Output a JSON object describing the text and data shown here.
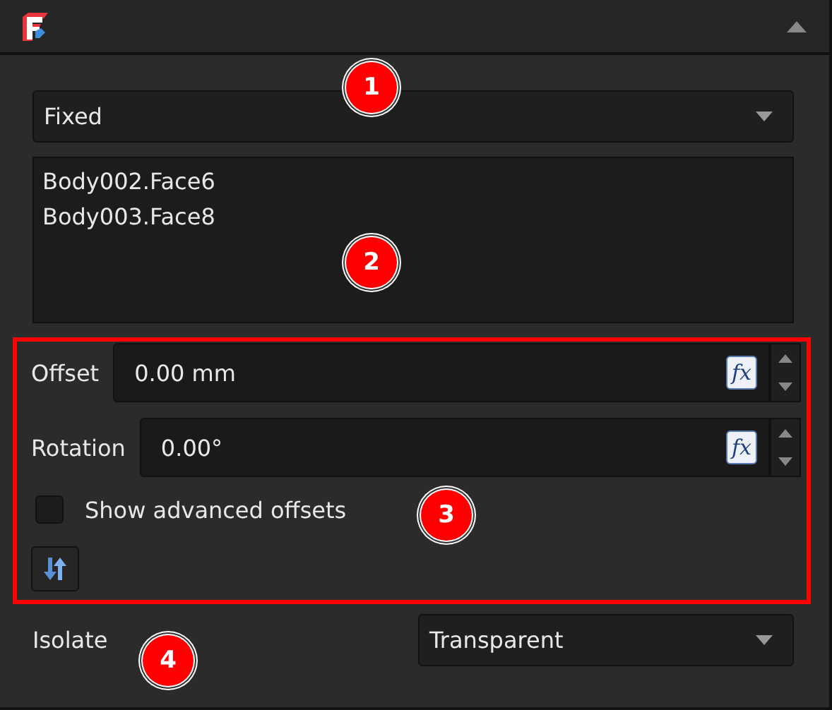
{
  "mode_dropdown": {
    "value": "Fixed"
  },
  "references": [
    "Body002.Face6",
    "Body003.Face8"
  ],
  "fields": [
    {
      "label": "Offset",
      "value": "0.00 mm",
      "expression": "fx"
    },
    {
      "label": "Rotation",
      "value": "0.00°",
      "expression": "fx"
    }
  ],
  "advanced_offsets": {
    "label": "Show advanced offsets",
    "checked": false
  },
  "isolate": {
    "label": "Isolate",
    "value": "Transparent"
  },
  "callouts": [
    "1",
    "2",
    "3",
    "4"
  ]
}
